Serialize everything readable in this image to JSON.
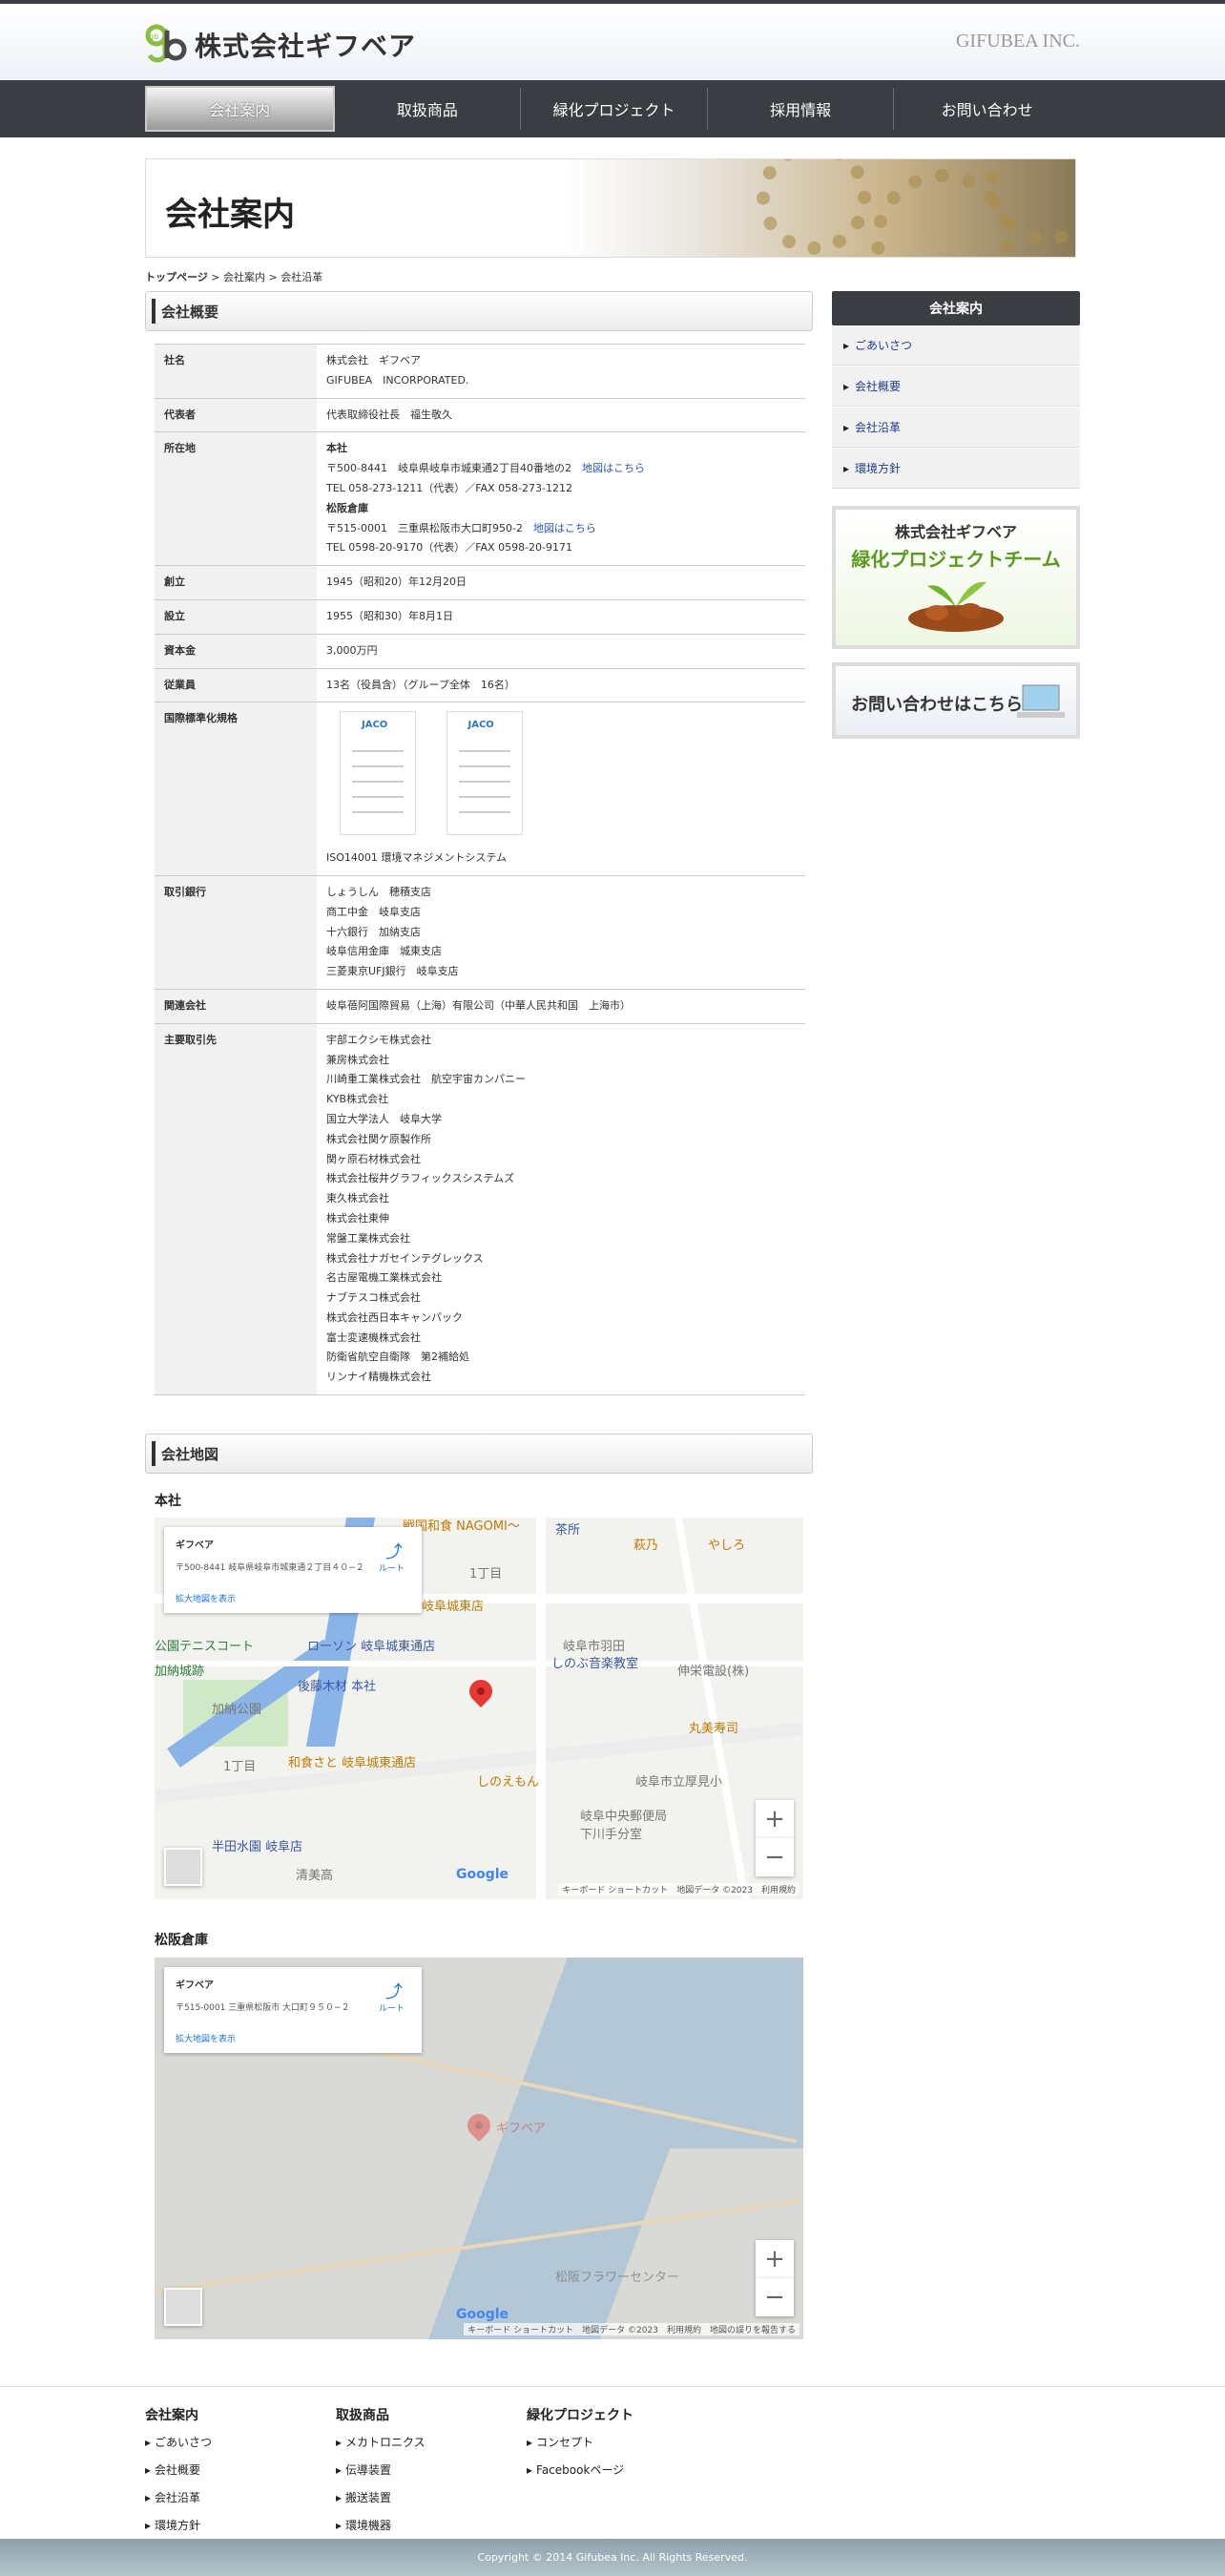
{
  "header": {
    "logo_mark": "gb",
    "logo_text": "株式会社ギフベア",
    "en_name": "GIFUBEA INC."
  },
  "nav": [
    {
      "label": "会社案内",
      "active": true
    },
    {
      "label": "取扱商品"
    },
    {
      "label": "緑化プロジェクト"
    },
    {
      "label": "採用情報"
    },
    {
      "label": "お問い合わせ"
    }
  ],
  "banner": {
    "title": "会社案内"
  },
  "breadcrumb": {
    "home": "トップページ",
    "sep1": " > ",
    "mid": "会社案内",
    "sep2": " > ",
    "current": "会社沿革"
  },
  "overview": {
    "heading": "会社概要",
    "rows": {
      "name": {
        "k": "社名",
        "v1": "株式会社　ギフベア",
        "v2": "GIFUBEA　INCORPORATED."
      },
      "rep": {
        "k": "代表者",
        "v": "代表取締役社長　福生敬久"
      },
      "addr": {
        "k": "所在地",
        "hq_label": "本社",
        "hq_addr": "〒500-8441　岐阜県岐阜市城東通2丁目40番地の2",
        "hq_map": "地図はこちら",
        "hq_tel": "TEL 058-273-1211（代表）／FAX 058-273-1212",
        "wh_label": "松阪倉庫",
        "wh_addr": "〒515-0001　三重県松阪市大口町950-2",
        "wh_map": "地図はこちら",
        "wh_tel": "TEL 0598-20-9170（代表）／FAX 0598-20-9171"
      },
      "founded": {
        "k": "創立",
        "v": "1945（昭和20）年12月20日"
      },
      "established": {
        "k": "設立",
        "v": "1955（昭和30）年8月1日"
      },
      "capital": {
        "k": "資本金",
        "v": "3,000万円"
      },
      "employees": {
        "k": "従業員",
        "v": "13名（役員含）（グループ全体　16名）"
      },
      "iso": {
        "k": "国際標準化規格",
        "v": "ISO14001 環境マネジメントシステム"
      },
      "banks": {
        "k": "取引銀行",
        "list": [
          "しょうしん　穂積支店",
          "商工中金　岐阜支店",
          "十六銀行　加納支店",
          "岐阜信用金庫　城東支店",
          "三菱東京UFJ銀行　岐阜支店"
        ]
      },
      "affiliate": {
        "k": "関連会社",
        "v": "岐阜蓓阿国際貿易（上海）有限公司（中華人民共和国　上海市）"
      },
      "clients": {
        "k": "主要取引先",
        "list": [
          "宇部エクシモ株式会社",
          "兼房株式会社",
          "川崎重工業株式会社　航空宇宙カンパニー",
          "KYB株式会社",
          "国立大学法人　岐阜大学",
          "株式会社関ケ原製作所",
          "関ヶ原石材株式会社",
          "株式会社桜井グラフィックスシステムズ",
          "東久株式会社",
          "株式会社東伸",
          "常盤工業株式会社",
          "株式会社ナガセインテグレックス",
          "名古屋電機工業株式会社",
          "ナブテスコ株式会社",
          "株式会社西日本キャンパック",
          "富士変速機株式会社",
          "防衛省航空自衛隊　第2補給処",
          "リンナイ精機株式会社"
        ]
      }
    }
  },
  "sidebar": {
    "heading": "会社案内",
    "items": [
      "ごあいさつ",
      "会社概要",
      "会社沿革",
      "環境方針"
    ],
    "green_project": {
      "line1": "株式会社ギフベア",
      "line2": "緑化プロジェクトチーム"
    },
    "contact_banner": "お問い合わせはこちら"
  },
  "map_section": {
    "heading": "会社地図",
    "hq": {
      "label": "本社",
      "card_title": "ギフベア",
      "card_addr": "〒500-8441 岐阜県岐阜市城東通２丁目４０−２",
      "card_link": "拡大地図を表示",
      "dir_label": "ルート",
      "pois": [
        "戦国和食 NAGOMI〜",
        "茶所",
        "萩乃",
        "やしろ",
        "1丁目",
        "岐阜城東店",
        "公園テニスコート",
        "ローソン 岐阜城東通店",
        "岐阜市羽田",
        "しのぶ音楽教室",
        "伸栄電設(株)",
        "加納城跡",
        "後藤木材 本社",
        "加納公園",
        "丸美寿司",
        "1丁目",
        "和食さと 岐阜城東通店",
        "しのえもん",
        "岐阜市立厚見小",
        "岐阜中央郵便局 下川手分室",
        "半田水園 岐阜店",
        "清美高",
        "Google",
        "キーボード ショートカット",
        "地図データ ©2023",
        "利用規約"
      ]
    },
    "warehouse": {
      "label": "松阪倉庫",
      "card_title": "ギフベア",
      "card_addr": "〒515-0001 三重県松阪市 大口町９５０−２",
      "card_link": "拡大地図を表示",
      "dir_label": "ルート",
      "pois": [
        "ギフベア",
        "松阪フラワーセンター",
        "Google",
        "キーボード ショートカット",
        "地図データ ©2023",
        "利用規約",
        "地図の誤りを報告する"
      ]
    }
  },
  "footer": {
    "cols": [
      {
        "title": "会社案内",
        "items": [
          "ごあいさつ",
          "会社概要",
          "会社沿革",
          "環境方針"
        ]
      },
      {
        "title": "取扱商品",
        "items": [
          "メカトロニクス",
          "伝導装置",
          "搬送装置",
          "環境機器"
        ]
      },
      {
        "title": "緑化プロジェクト",
        "items": [
          "コンセプト",
          "Facebookページ"
        ]
      }
    ],
    "copyright": "Copyright © 2014 Gifubea Inc. All Rights Reserved."
  },
  "colors": {
    "nav_bg": "#3a3d42",
    "link": "#2a55c9",
    "pin": "#e53935"
  }
}
